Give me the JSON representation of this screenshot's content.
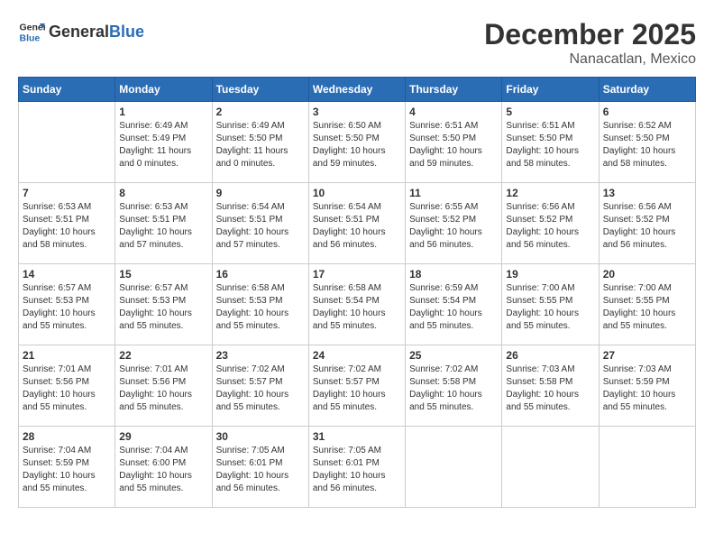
{
  "header": {
    "logo_general": "General",
    "logo_blue": "Blue",
    "month_title": "December 2025",
    "location": "Nanacatlan, Mexico"
  },
  "weekdays": [
    "Sunday",
    "Monday",
    "Tuesday",
    "Wednesday",
    "Thursday",
    "Friday",
    "Saturday"
  ],
  "weeks": [
    [
      {
        "day": "",
        "info": ""
      },
      {
        "day": "1",
        "info": "Sunrise: 6:49 AM\nSunset: 5:49 PM\nDaylight: 11 hours\nand 0 minutes."
      },
      {
        "day": "2",
        "info": "Sunrise: 6:49 AM\nSunset: 5:50 PM\nDaylight: 11 hours\nand 0 minutes."
      },
      {
        "day": "3",
        "info": "Sunrise: 6:50 AM\nSunset: 5:50 PM\nDaylight: 10 hours\nand 59 minutes."
      },
      {
        "day": "4",
        "info": "Sunrise: 6:51 AM\nSunset: 5:50 PM\nDaylight: 10 hours\nand 59 minutes."
      },
      {
        "day": "5",
        "info": "Sunrise: 6:51 AM\nSunset: 5:50 PM\nDaylight: 10 hours\nand 58 minutes."
      },
      {
        "day": "6",
        "info": "Sunrise: 6:52 AM\nSunset: 5:50 PM\nDaylight: 10 hours\nand 58 minutes."
      }
    ],
    [
      {
        "day": "7",
        "info": "Sunrise: 6:53 AM\nSunset: 5:51 PM\nDaylight: 10 hours\nand 58 minutes."
      },
      {
        "day": "8",
        "info": "Sunrise: 6:53 AM\nSunset: 5:51 PM\nDaylight: 10 hours\nand 57 minutes."
      },
      {
        "day": "9",
        "info": "Sunrise: 6:54 AM\nSunset: 5:51 PM\nDaylight: 10 hours\nand 57 minutes."
      },
      {
        "day": "10",
        "info": "Sunrise: 6:54 AM\nSunset: 5:51 PM\nDaylight: 10 hours\nand 56 minutes."
      },
      {
        "day": "11",
        "info": "Sunrise: 6:55 AM\nSunset: 5:52 PM\nDaylight: 10 hours\nand 56 minutes."
      },
      {
        "day": "12",
        "info": "Sunrise: 6:56 AM\nSunset: 5:52 PM\nDaylight: 10 hours\nand 56 minutes."
      },
      {
        "day": "13",
        "info": "Sunrise: 6:56 AM\nSunset: 5:52 PM\nDaylight: 10 hours\nand 56 minutes."
      }
    ],
    [
      {
        "day": "14",
        "info": "Sunrise: 6:57 AM\nSunset: 5:53 PM\nDaylight: 10 hours\nand 55 minutes."
      },
      {
        "day": "15",
        "info": "Sunrise: 6:57 AM\nSunset: 5:53 PM\nDaylight: 10 hours\nand 55 minutes."
      },
      {
        "day": "16",
        "info": "Sunrise: 6:58 AM\nSunset: 5:53 PM\nDaylight: 10 hours\nand 55 minutes."
      },
      {
        "day": "17",
        "info": "Sunrise: 6:58 AM\nSunset: 5:54 PM\nDaylight: 10 hours\nand 55 minutes."
      },
      {
        "day": "18",
        "info": "Sunrise: 6:59 AM\nSunset: 5:54 PM\nDaylight: 10 hours\nand 55 minutes."
      },
      {
        "day": "19",
        "info": "Sunrise: 7:00 AM\nSunset: 5:55 PM\nDaylight: 10 hours\nand 55 minutes."
      },
      {
        "day": "20",
        "info": "Sunrise: 7:00 AM\nSunset: 5:55 PM\nDaylight: 10 hours\nand 55 minutes."
      }
    ],
    [
      {
        "day": "21",
        "info": "Sunrise: 7:01 AM\nSunset: 5:56 PM\nDaylight: 10 hours\nand 55 minutes."
      },
      {
        "day": "22",
        "info": "Sunrise: 7:01 AM\nSunset: 5:56 PM\nDaylight: 10 hours\nand 55 minutes."
      },
      {
        "day": "23",
        "info": "Sunrise: 7:02 AM\nSunset: 5:57 PM\nDaylight: 10 hours\nand 55 minutes."
      },
      {
        "day": "24",
        "info": "Sunrise: 7:02 AM\nSunset: 5:57 PM\nDaylight: 10 hours\nand 55 minutes."
      },
      {
        "day": "25",
        "info": "Sunrise: 7:02 AM\nSunset: 5:58 PM\nDaylight: 10 hours\nand 55 minutes."
      },
      {
        "day": "26",
        "info": "Sunrise: 7:03 AM\nSunset: 5:58 PM\nDaylight: 10 hours\nand 55 minutes."
      },
      {
        "day": "27",
        "info": "Sunrise: 7:03 AM\nSunset: 5:59 PM\nDaylight: 10 hours\nand 55 minutes."
      }
    ],
    [
      {
        "day": "28",
        "info": "Sunrise: 7:04 AM\nSunset: 5:59 PM\nDaylight: 10 hours\nand 55 minutes."
      },
      {
        "day": "29",
        "info": "Sunrise: 7:04 AM\nSunset: 6:00 PM\nDaylight: 10 hours\nand 55 minutes."
      },
      {
        "day": "30",
        "info": "Sunrise: 7:05 AM\nSunset: 6:01 PM\nDaylight: 10 hours\nand 56 minutes."
      },
      {
        "day": "31",
        "info": "Sunrise: 7:05 AM\nSunset: 6:01 PM\nDaylight: 10 hours\nand 56 minutes."
      },
      {
        "day": "",
        "info": ""
      },
      {
        "day": "",
        "info": ""
      },
      {
        "day": "",
        "info": ""
      }
    ]
  ]
}
